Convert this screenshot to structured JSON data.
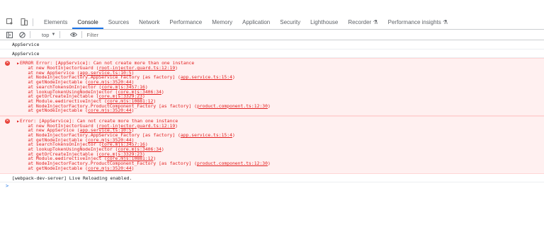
{
  "tabs": [
    "Elements",
    "Console",
    "Sources",
    "Network",
    "Performance",
    "Memory",
    "Application",
    "Security",
    "Lighthouse",
    "Recorder",
    "Performance insights"
  ],
  "toolbar": {
    "context": "top",
    "filter_placeholder": "Filter"
  },
  "messages": [
    {
      "type": "log",
      "text": "AppService"
    },
    {
      "type": "log",
      "text": "AppService"
    },
    {
      "type": "error",
      "lines": [
        {
          "pre": "ERROR Error: [AppService]: Can not create more than one instance"
        },
        {
          "pre": "    at new RootInjectorGuard (",
          "link": "root-injector.guard.ts:12:19",
          "post": ")"
        },
        {
          "pre": "    at new AppService (",
          "link": "app.service.ts:10:5",
          "post": ")"
        },
        {
          "pre": "    at NodeInjectorFactory.AppService_Factory [as factory] (",
          "link": "app.service.ts:15:4",
          "post": ")"
        },
        {
          "pre": "    at getNodeInjectable (",
          "link": "core.mjs:3520:44",
          "post": ")"
        },
        {
          "pre": "    at searchTokensOnInjector (",
          "link": "core.mjs:3457:16",
          "post": ")"
        },
        {
          "pre": "    at lookupTokenUsingNodeInjector (",
          "link": "core.mjs:3406:34",
          "post": ")"
        },
        {
          "pre": "    at getOrCreateInjectable (",
          "link": "core.mjs:3329:23",
          "post": ")"
        },
        {
          "pre": "    at Module.ɵɵdirectiveInject (",
          "link": "core.mjs:10881:12",
          "post": ")"
        },
        {
          "pre": "    at NodeInjectorFactory.ProductComponent_Factory [as factory] (",
          "link": "product.component.ts:12:30",
          "post": ")"
        },
        {
          "pre": "    at getNodeInjectable (",
          "link": "core.mjs:3520:44",
          "post": ")"
        }
      ]
    },
    {
      "type": "error",
      "lines": [
        {
          "pre": "Error: [AppService]: Can not create more than one instance"
        },
        {
          "pre": "    at new RootInjectorGuard (",
          "link": "root-injector.guard.ts:12:19",
          "post": ")"
        },
        {
          "pre": "    at new AppService (",
          "link": "app.service.ts:10:5",
          "post": ")"
        },
        {
          "pre": "    at NodeInjectorFactory.AppService_Factory [as factory] (",
          "link": "app.service.ts:15:4",
          "post": ")"
        },
        {
          "pre": "    at getNodeInjectable (",
          "link": "core.mjs:3520:44",
          "post": ")"
        },
        {
          "pre": "    at searchTokensOnInjector (",
          "link": "core.mjs:3457:16",
          "post": ")"
        },
        {
          "pre": "    at lookupTokenUsingNodeInjector (",
          "link": "core.mjs:3406:34",
          "post": ")"
        },
        {
          "pre": "    at getOrCreateInjectable (",
          "link": "core.mjs:3329:23",
          "post": ")"
        },
        {
          "pre": "    at Module.ɵɵdirectiveInject (",
          "link": "core.mjs:10881:12",
          "post": ")"
        },
        {
          "pre": "    at NodeInjectorFactory.ProductComponent_Factory [as factory] (",
          "link": "product.component.ts:12:30",
          "post": ")"
        },
        {
          "pre": "    at getNodeInjectable (",
          "link": "core.mjs:3520:44",
          "post": ")"
        }
      ]
    },
    {
      "type": "log",
      "text": "[webpack-dev-server] Live Reloading enabled."
    }
  ],
  "prompt": ">"
}
